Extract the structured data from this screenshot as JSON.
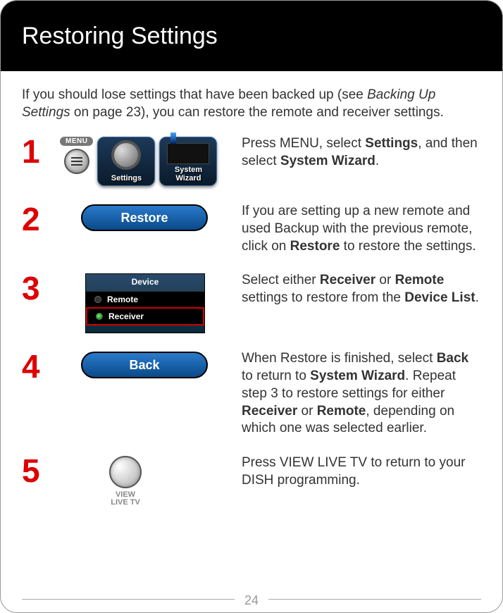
{
  "header": {
    "title": "Restoring Settings"
  },
  "intro": {
    "text_before_ref": "If you should lose settings that have been backed up (see ",
    "ref": "Backing Up Settings",
    "text_after_ref": " on page 23), you can restore the remote and receiver settings."
  },
  "steps": [
    {
      "num": "1",
      "menu_pill": "MENU",
      "tile1_label": "Settings",
      "tile2_label_line1": "System",
      "tile2_label_line2": "Wizard",
      "text_parts": [
        "Press MENU, select ",
        "Settings",
        ", and then select ",
        "System Wizard",
        "."
      ]
    },
    {
      "num": "2",
      "button_label": "Restore",
      "text_parts": [
        "If you are setting up a new remote and used Backup with the previous remote, click on ",
        "Restore",
        " to restore the settings."
      ]
    },
    {
      "num": "3",
      "panel_head": "Device",
      "panel_row1": "Remote",
      "panel_row2": "Receiver",
      "text_parts": [
        "Select either ",
        "Receiver",
        " or ",
        "Remote",
        " settings to restore from the ",
        "Device List",
        "."
      ]
    },
    {
      "num": "4",
      "button_label": "Back",
      "text_parts": [
        "When Restore is finished, select ",
        "Back",
        " to return to ",
        "System Wizard",
        ". Repeat step 3 to restore settings for either ",
        "Receiver",
        " or ",
        "Remote",
        ", depending on which one was selected earlier."
      ]
    },
    {
      "num": "5",
      "vlt_line1": "VIEW",
      "vlt_line2": "LIVE TV",
      "text_parts": [
        "Press VIEW LIVE TV to return to your DISH programming."
      ]
    }
  ],
  "page_number": "24"
}
